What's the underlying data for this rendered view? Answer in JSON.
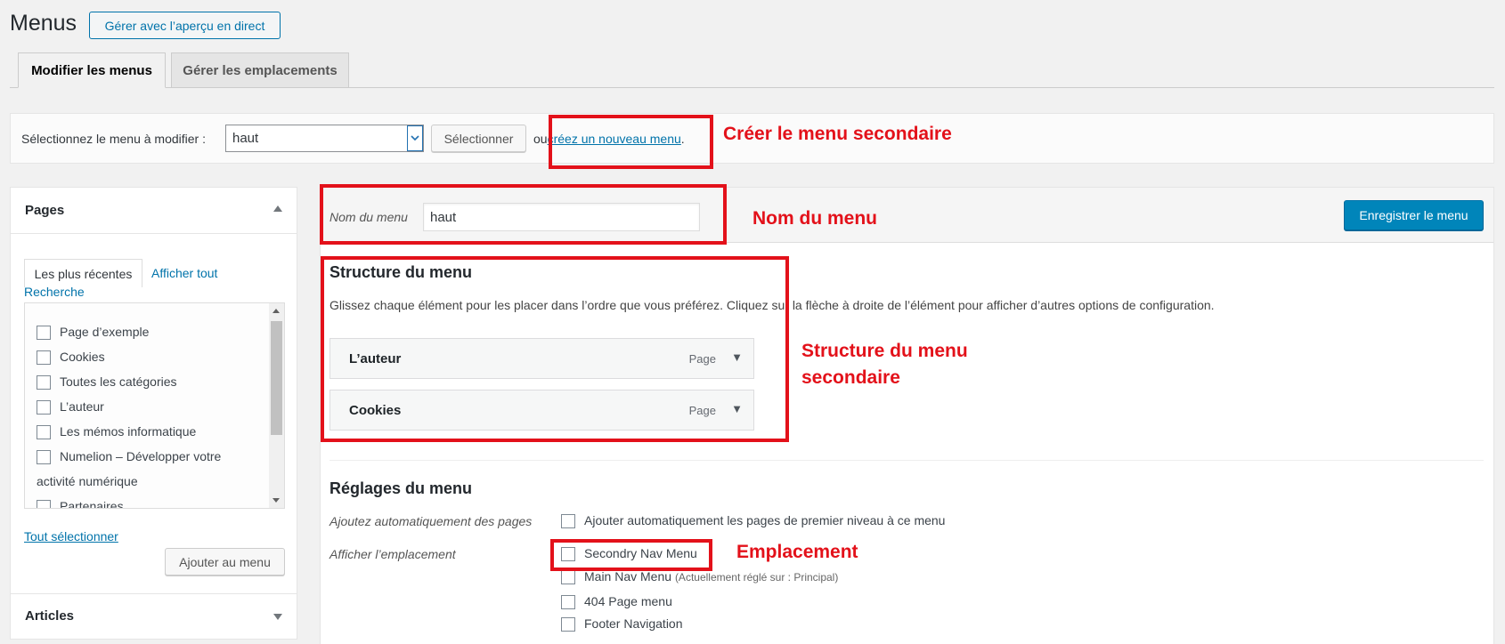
{
  "header": {
    "title": "Menus",
    "live_preview_button": "Gérer avec l’aperçu en direct"
  },
  "tabs": [
    {
      "label": "Modifier les menus",
      "active": true
    },
    {
      "label": "Gérer les emplacements",
      "active": false
    }
  ],
  "select_bar": {
    "label": "Sélectionnez le menu à modifier :",
    "selected": "haut",
    "select_button": "Sélectionner",
    "or_text": "ou",
    "create_link": "créez un nouveau menu",
    "period": "."
  },
  "pages_panel": {
    "title": "Pages",
    "tab_recent": "Les plus récentes",
    "tab_all": "Afficher tout",
    "tab_search": "Recherche",
    "items": [
      "Page d’exemple",
      "Cookies",
      "Toutes les catégories",
      "L’auteur",
      "Les mémos informatique",
      "Numelion – Développer votre",
      "activité numérique",
      "Partenaires"
    ],
    "select_all": "Tout sélectionner",
    "add_button": "Ajouter au menu"
  },
  "articles_panel": {
    "title": "Articles"
  },
  "menu_editor": {
    "name_label": "Nom du menu",
    "name_value": "haut",
    "save_button": "Enregistrer le menu",
    "structure_title": "Structure du menu",
    "structure_help": "Glissez chaque élément pour les placer dans l’ordre que vous préférez. Cliquez sur la flèche à droite de l’élément pour afficher d’autres options de configuration.",
    "items": [
      {
        "title": "L’auteur",
        "type": "Page"
      },
      {
        "title": "Cookies",
        "type": "Page"
      }
    ],
    "settings_title": "Réglages du menu",
    "auto_add_label": "Ajoutez automatiquement des pages",
    "auto_add_option": "Ajouter automatiquement les pages de premier niveau à ce menu",
    "location_label": "Afficher l’emplacement",
    "locations": [
      {
        "name": "Secondry Nav Menu",
        "note": ""
      },
      {
        "name": "Main Nav Menu",
        "note": "(Actuellement réglé sur : Principal)"
      },
      {
        "name": "404 Page menu",
        "note": ""
      },
      {
        "name": "Footer Navigation",
        "note": ""
      }
    ]
  },
  "annotations": {
    "create": "Créer le menu secondaire",
    "name": "Nom du menu",
    "structure_line1": "Structure du menu",
    "structure_line2": "secondaire",
    "location": "Emplacement"
  },
  "colors": {
    "accent": "#0073aa",
    "primary_button": "#0085ba",
    "annotation": "#e3111a"
  }
}
